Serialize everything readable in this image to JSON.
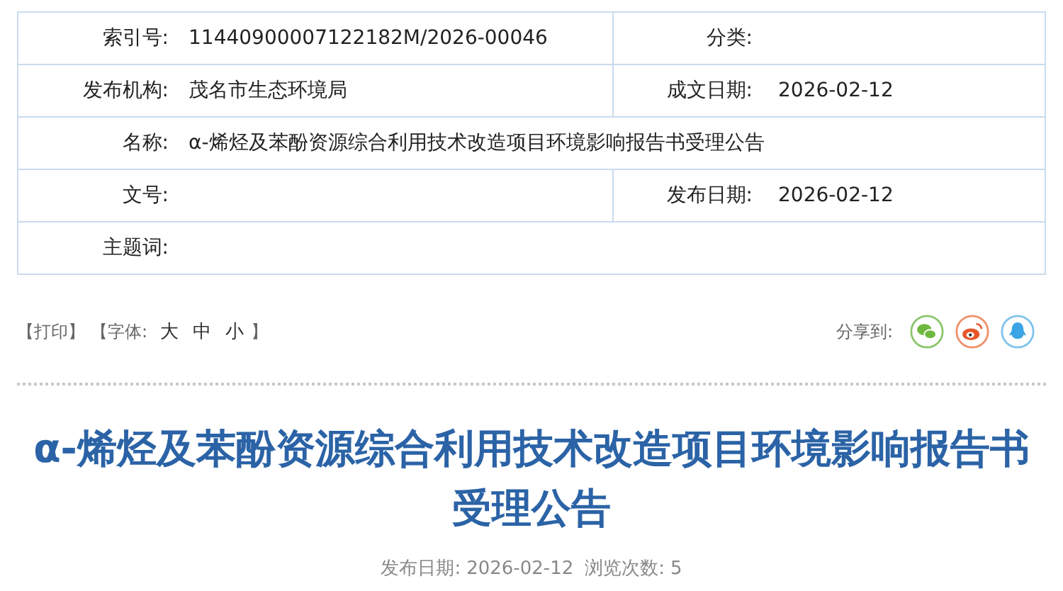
{
  "meta_rows": [
    {
      "kind": "pair",
      "cells": [
        {
          "label": "索引号:",
          "value": "11440900007122182M/2026-00046"
        },
        {
          "label": "分类:"
        }
      ]
    },
    {
      "kind": "pair",
      "cells": [
        {
          "label": "发布机构:",
          "value": "茂名市生态环境局"
        },
        {
          "label": "成文日期:",
          "value": "2026-02-12"
        }
      ]
    },
    {
      "kind": "full",
      "cells": [
        {
          "label": "名称:",
          "value": "α-烯烃及苯酚资源综合利用技术改造项目环境影响报告书受理公告"
        }
      ]
    },
    {
      "kind": "pair",
      "cells": [
        {
          "label": "文号:"
        },
        {
          "label": "发布日期:",
          "value": "2026-02-12"
        }
      ]
    },
    {
      "kind": "full",
      "cells": [
        {
          "label": "主题词:"
        }
      ]
    }
  ],
  "toolbar": {
    "print": "【打印】",
    "font_label": "【字体:",
    "font_sizes": [
      "大",
      "中",
      "小"
    ],
    "font_close": "】",
    "share_label": "分享到:"
  },
  "article": {
    "title": "α-烯烃及苯酚资源综合利用技术改造项目环境影响报告书受理公告",
    "date_label": "发布日期:",
    "date": "2026-02-12",
    "views_label": "浏览次数:",
    "views": "5"
  }
}
